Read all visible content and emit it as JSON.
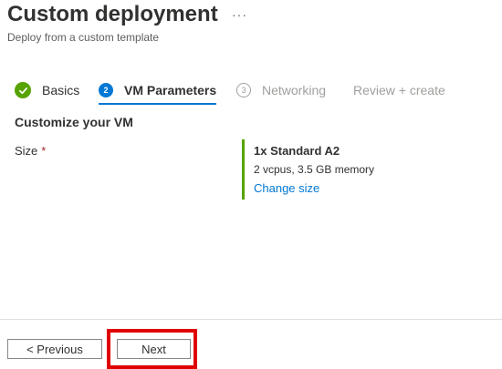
{
  "header": {
    "title": "Custom deployment",
    "more_label": "···",
    "subtitle": "Deploy from a custom template"
  },
  "wizard": {
    "tabs": [
      {
        "label": "Basics",
        "status": "complete",
        "icon": "checkmark-icon"
      },
      {
        "label": "VM Parameters",
        "status": "current",
        "number": "2"
      },
      {
        "label": "Networking",
        "status": "pending",
        "number": "3"
      },
      {
        "label": "Review + create",
        "status": "pending"
      }
    ]
  },
  "main": {
    "section_title": "Customize your VM",
    "size_field": {
      "label": "Size",
      "required_marker": "*",
      "value_name": "1x Standard A2",
      "value_description": "2 vcpus, 3.5 GB memory",
      "change_link": "Change size"
    }
  },
  "footer": {
    "previous_label": "< Previous",
    "next_label": "Next"
  },
  "colors": {
    "accent": "#0078d4",
    "success": "#57a300",
    "highlight": "#e00000",
    "required": "#a4262c"
  }
}
